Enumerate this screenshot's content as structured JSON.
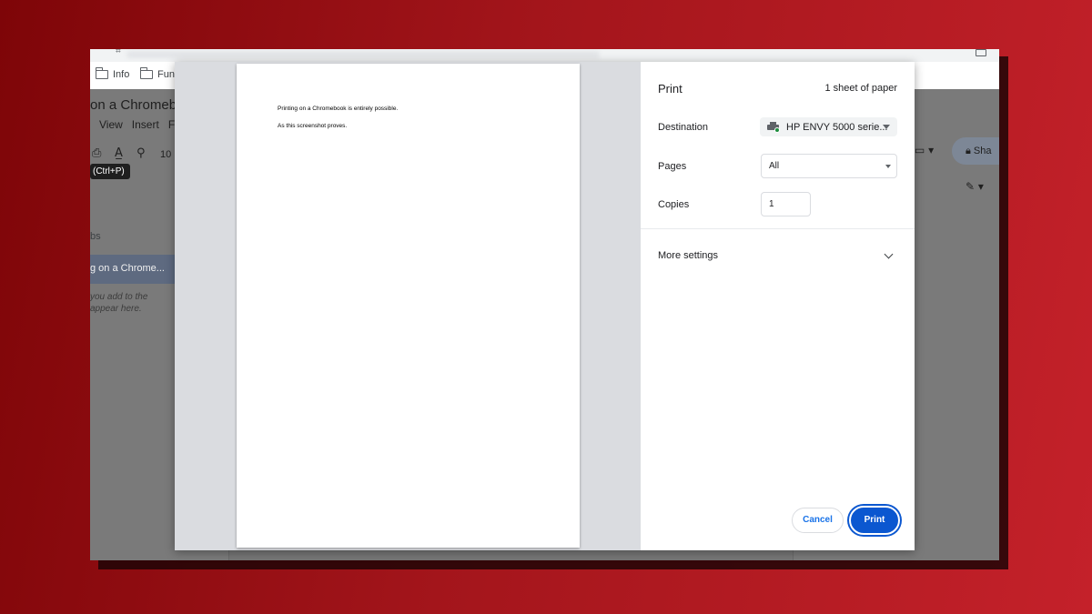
{
  "colors": {
    "background_red": "#b01a20",
    "accent_blue": "#0b57d0",
    "cancel_text_blue": "#1a73e8"
  },
  "bookmarks": [
    {
      "label": "Info",
      "icon": "folder-icon"
    },
    {
      "label": "Fun",
      "icon": "folder-icon"
    }
  ],
  "docs": {
    "title_fragment": "on a Chromebo",
    "menu": [
      "View",
      "Insert",
      "F"
    ],
    "zoom_fragment": "10",
    "tooltip": "(Ctrl+P)",
    "tabs_label_fragment": "bs",
    "outline_item": "g on a Chrome...",
    "hint_line1": "you add to the",
    "hint_line2": "appear here.",
    "share_fragment": "Sha"
  },
  "print_dialog": {
    "title": "Print",
    "sheets": "1 sheet of paper",
    "destination_label": "Destination",
    "destination_value": "HP ENVY 5000 serie...",
    "pages_label": "Pages",
    "pages_value": "All",
    "copies_label": "Copies",
    "copies_value": "1",
    "more_settings": "More settings",
    "cancel_label": "Cancel",
    "print_label": "Print"
  },
  "preview_page": {
    "line1": "Printing on a Chromebook is entirely possible.",
    "line2": "As this screenshot proves."
  }
}
